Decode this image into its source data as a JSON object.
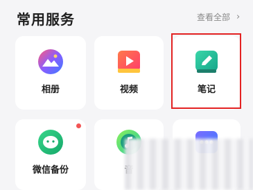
{
  "section": {
    "title": "常用服务",
    "view_all_label": "查看全部",
    "view_all_chevron": "›"
  },
  "services": [
    {
      "id": "photos",
      "label": "相册",
      "icon": "photo-album-icon"
    },
    {
      "id": "video",
      "label": "视频",
      "icon": "video-play-icon"
    },
    {
      "id": "notes",
      "label": "笔记",
      "icon": "notes-pen-icon",
      "highlighted": true
    },
    {
      "id": "wechat-backup",
      "label": "微信备份",
      "icon": "wechat-backup-icon",
      "has_notification_dot": true
    },
    {
      "id": "music",
      "label": "音",
      "icon": "music-note-icon"
    },
    {
      "id": "more",
      "label": "",
      "icon": "dots-app-icon"
    }
  ],
  "colors": {
    "highlight_border": "#e32222",
    "notification_dot": "#f25555",
    "background": "#f5f5f7",
    "card": "#ffffff"
  }
}
